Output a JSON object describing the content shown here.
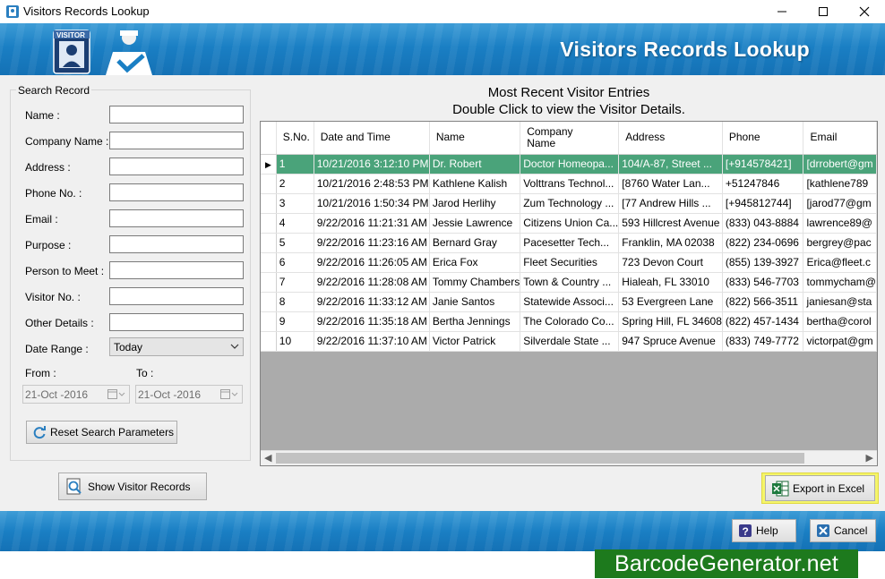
{
  "window": {
    "title": "Visitors Records Lookup",
    "controls": [
      "minimize",
      "maximize",
      "close"
    ]
  },
  "header": {
    "title": "Visitors Records Lookup",
    "logo_text": "VISITOR"
  },
  "search": {
    "legend": "Search Record",
    "fields": [
      {
        "label": "Name :",
        "value": ""
      },
      {
        "label": "Company Name :",
        "value": ""
      },
      {
        "label": "Address :",
        "value": ""
      },
      {
        "label": "Phone No. :",
        "value": ""
      },
      {
        "label": "Email :",
        "value": ""
      },
      {
        "label": "Purpose :",
        "value": ""
      },
      {
        "label": "Person to Meet :",
        "value": ""
      },
      {
        "label": "Visitor No. :",
        "value": ""
      },
      {
        "label": "Other Details :",
        "value": ""
      }
    ],
    "date_range_label": "Date Range :",
    "date_range_value": "Today",
    "from_label": "From :",
    "to_label": "To :",
    "from_value": "21-Oct -2016",
    "to_value": "21-Oct -2016",
    "reset_button": "Reset Search Parameters",
    "show_button": "Show Visitor Records"
  },
  "grid": {
    "caption_line1": "Most Recent Visitor Entries",
    "caption_line2": "Double Click to view the Visitor Details.",
    "columns": [
      "S.No.",
      "Date and Time",
      "Name",
      "Company Name",
      "Address",
      "Phone",
      "Email"
    ],
    "rows": [
      [
        "1",
        "10/21/2016 3:12:10 PM",
        "Dr. Robert",
        "Doctor Homeopa...",
        "104/A-87, Street ...",
        "[+914578421]",
        "[drrobert@gm"
      ],
      [
        "2",
        "10/21/2016 2:48:53 PM",
        "Kathlene Kalish",
        "Volttrans Technol...",
        "[8760 Water Lan...",
        "+51247846",
        "[kathlene789"
      ],
      [
        "3",
        "10/21/2016 1:50:34 PM",
        "Jarod Herlihy",
        "Zum Technology ...",
        "[77 Andrew Hills ...",
        "[+945812744]",
        "[jarod77@gm"
      ],
      [
        "4",
        "9/22/2016 11:21:31 AM",
        "Jessie Lawrence",
        "Citizens Union Ca...",
        "593 Hillcrest Avenue",
        "(833) 043-8884",
        "lawrence89@"
      ],
      [
        "5",
        "9/22/2016 11:23:16 AM",
        "Bernard Gray",
        "Pacesetter Tech...",
        "Franklin, MA 02038",
        "(822) 234-0696",
        "bergrey@pac"
      ],
      [
        "6",
        "9/22/2016 11:26:05 AM",
        "Erica Fox",
        "Fleet Securities",
        "723 Devon Court",
        "(855) 139-3927",
        "Erica@fleet.c"
      ],
      [
        "7",
        "9/22/2016 11:28:08 AM",
        "Tommy Chambers",
        "Town & Country ...",
        "Hialeah, FL 33010",
        "(833) 546-7703",
        "tommycham@"
      ],
      [
        "8",
        "9/22/2016 11:33:12 AM",
        "Janie Santos",
        "Statewide Associ...",
        "53 Evergreen Lane",
        "(822) 566-3511",
        "janiesan@sta"
      ],
      [
        "9",
        "9/22/2016 11:35:18 AM",
        "Bertha Jennings",
        "The Colorado Co...",
        "Spring Hill, FL 34608",
        "(822) 457-1434",
        "bertha@corol"
      ],
      [
        "10",
        "9/22/2016 11:37:10 AM",
        "Victor Patrick",
        "Silverdale State ...",
        "947 Spruce Avenue",
        "(833) 749-7772",
        "victorpat@gm"
      ]
    ],
    "selected_row": 1,
    "selection_color": "#4aa37a",
    "row_indicator_icon": "current-row-arrow-icon"
  },
  "actions": {
    "export_button": "Export in Excel",
    "help_button": "Help",
    "cancel_button": "Cancel",
    "export_highlight_color": "#f5f56a"
  },
  "watermark": "BarcodeGenerator.net",
  "colors": {
    "banner": "#1a7fc4",
    "watermark_bg": "#1d7a1d"
  }
}
